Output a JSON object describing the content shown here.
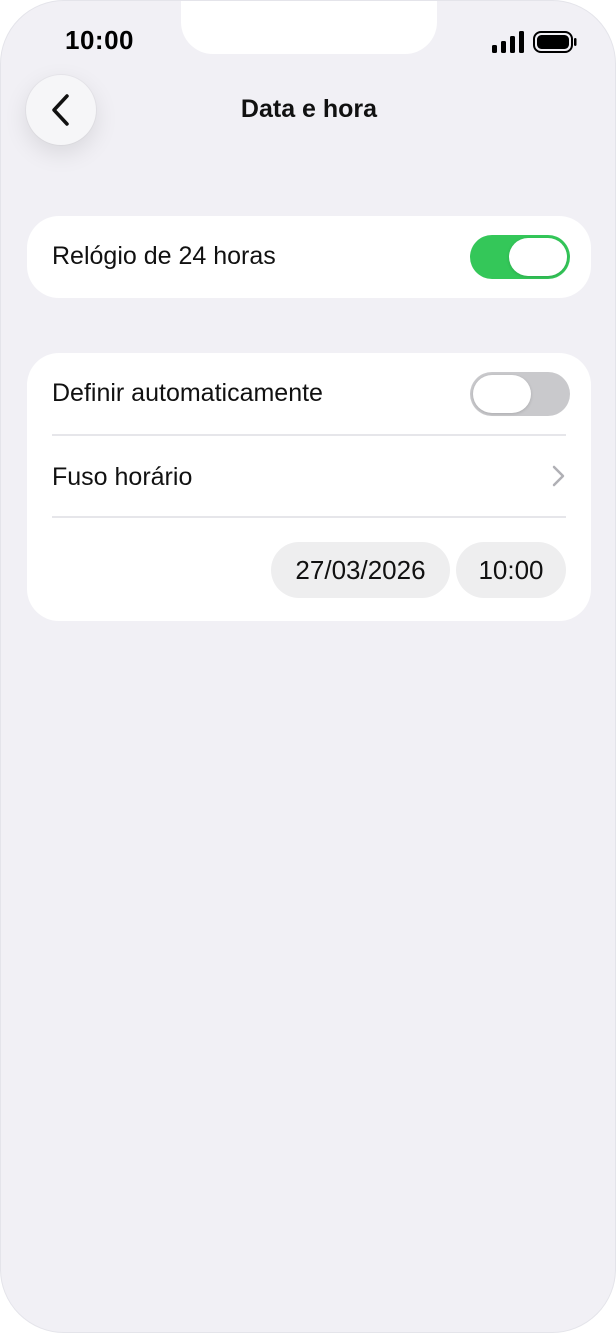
{
  "status_bar": {
    "time": "10:00",
    "signal_icon": "cellular-signal-icon",
    "battery_icon": "battery-icon"
  },
  "header": {
    "back_icon": "chevron-left-icon",
    "title": "Data e hora"
  },
  "section_1": {
    "clock_24h_label": "Relógio de 24 horas",
    "clock_24h_on": true
  },
  "section_2": {
    "auto_set_label": "Definir automaticamente",
    "auto_set_on": false,
    "timezone_label": "Fuso horário",
    "timezone_chevron_icon": "chevron-right-icon",
    "date_value": "27/03/2026",
    "time_value": "10:00"
  },
  "colors": {
    "toggle_on": "#34c759",
    "toggle_off": "#c9c9cc",
    "background": "#f1f0f5",
    "card": "#ffffff"
  }
}
